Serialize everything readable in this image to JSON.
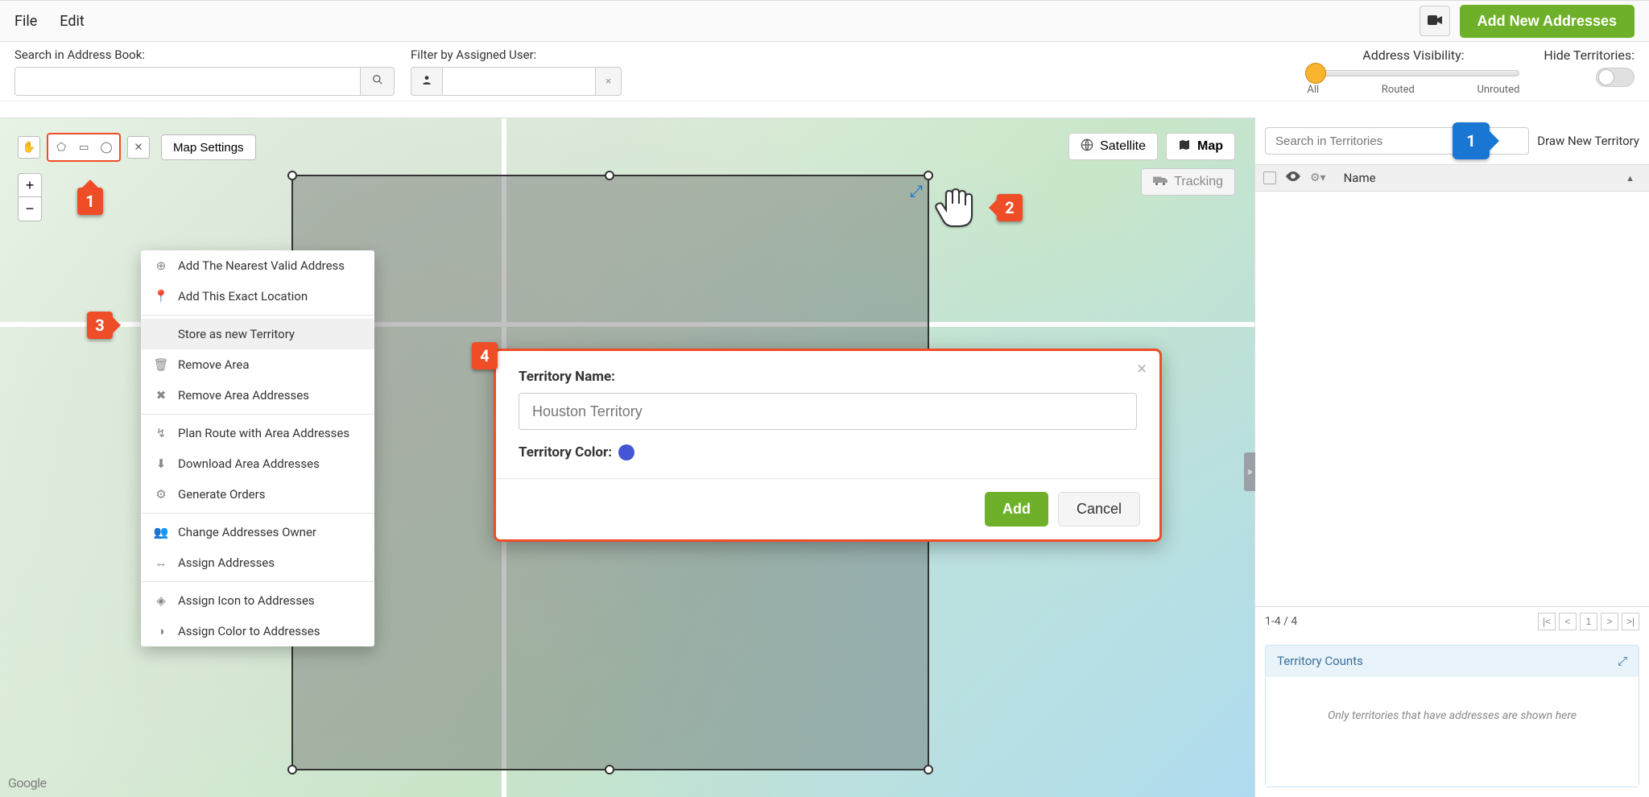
{
  "menu": {
    "file": "File",
    "edit": "Edit",
    "add_new_addresses": "Add New Addresses"
  },
  "secondbar": {
    "search_label": "Search in Address Book:",
    "filter_label": "Filter by Assigned User:",
    "visibility_label": "Address Visibility:",
    "vis_all": "All",
    "vis_routed": "Routed",
    "vis_unrouted": "Unrouted",
    "hide_label": "Hide Territories:"
  },
  "map": {
    "settings": "Map Settings",
    "satellite": "Satellite",
    "map": "Map",
    "tracking": "Tracking",
    "google": "Google"
  },
  "context_menu": {
    "add_nearest": "Add The Nearest Valid Address",
    "add_exact": "Add This Exact Location",
    "store_territory": "Store as new Territory",
    "remove_area": "Remove Area",
    "remove_area_addresses": "Remove Area Addresses",
    "plan_route": "Plan Route with Area Addresses",
    "download_addresses": "Download Area Addresses",
    "generate_orders": "Generate Orders",
    "change_owner": "Change Addresses Owner",
    "assign_addresses": "Assign Addresses",
    "assign_icon": "Assign Icon to Addresses",
    "assign_color": "Assign Color to Addresses"
  },
  "modal": {
    "name_label": "Territory Name:",
    "name_placeholder": "Houston Territory",
    "color_label": "Territory Color:",
    "territory_color": "#4456d6",
    "add": "Add",
    "cancel": "Cancel"
  },
  "sidebar": {
    "search_placeholder": "Search in Territories",
    "draw_new": "Draw New Territory",
    "name_header": "Name",
    "page_info": "1-4 / 4",
    "pager_current": "1",
    "counts_title": "Territory Counts",
    "counts_empty": "Only territories that have addresses are shown here"
  },
  "callouts": {
    "c1": "1",
    "c2": "2",
    "c3": "3",
    "c4": "4",
    "s1": "1"
  }
}
